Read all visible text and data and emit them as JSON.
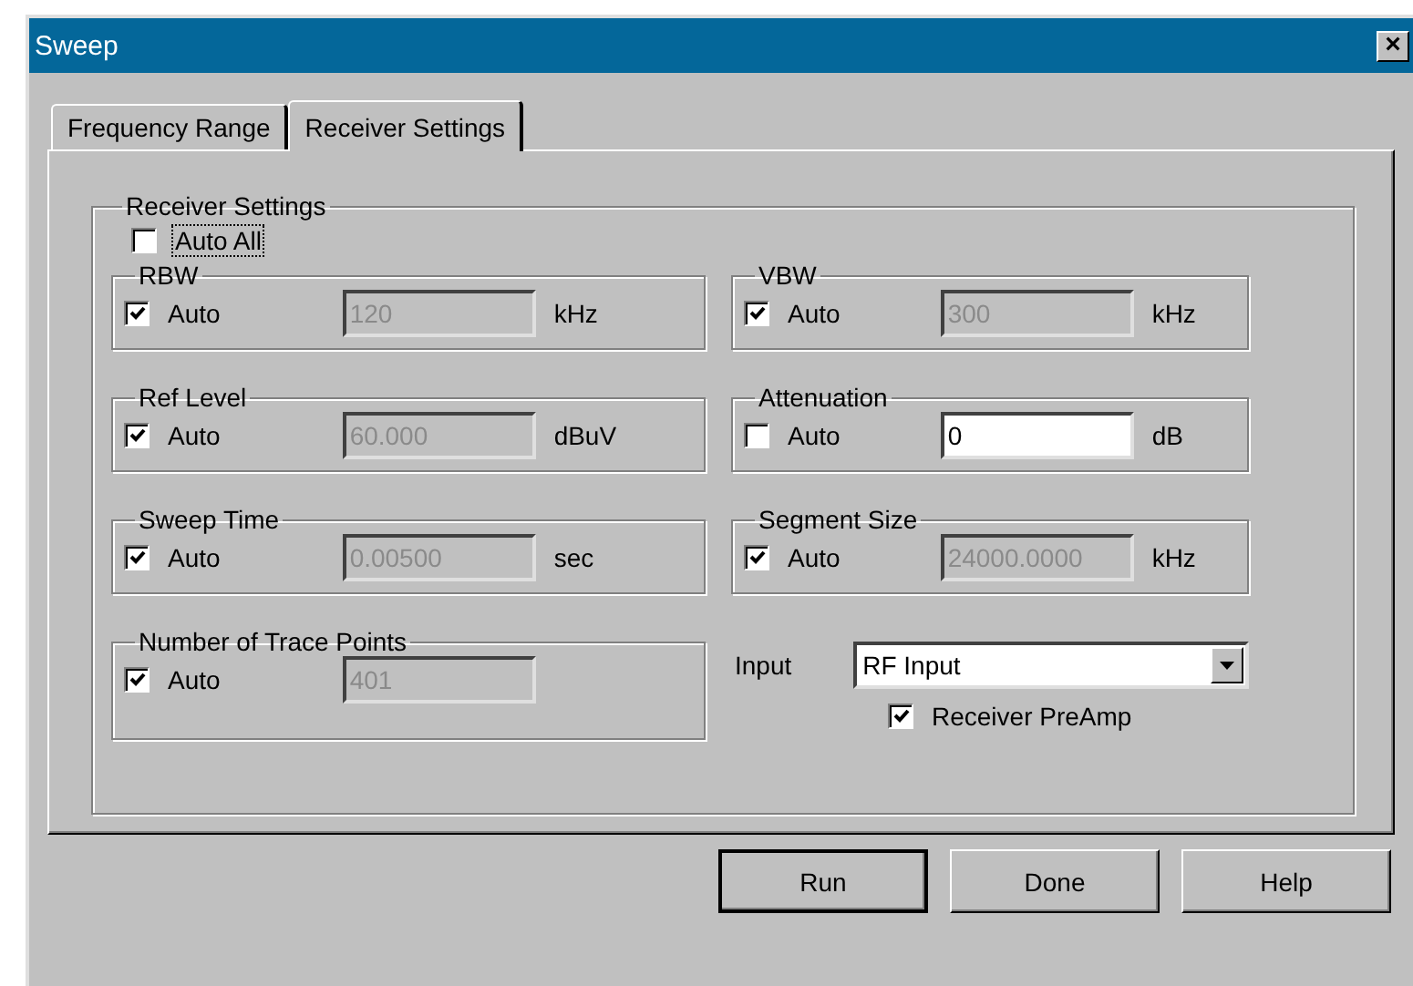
{
  "window": {
    "title": "Sweep",
    "close": "×"
  },
  "tabs": [
    {
      "label": "Frequency Range",
      "selected": false
    },
    {
      "label": "Receiver Settings",
      "selected": true
    }
  ],
  "panel": {
    "title": "Receiver Settings",
    "auto_all": {
      "label": "Auto All",
      "checked": false,
      "focused": true
    },
    "groups": [
      {
        "title": "RBW",
        "auto_label": "Auto",
        "auto": true,
        "value": "120",
        "disabled": true,
        "unit": "kHz"
      },
      {
        "title": "VBW",
        "auto_label": "Auto",
        "auto": true,
        "value": "300",
        "disabled": true,
        "unit": "kHz"
      },
      {
        "title": "Ref Level",
        "auto_label": "Auto",
        "auto": true,
        "value": "60.000",
        "disabled": true,
        "unit": "dBuV"
      },
      {
        "title": "Attenuation",
        "auto_label": "Auto",
        "auto": false,
        "value": "0",
        "disabled": false,
        "unit": "dB"
      },
      {
        "title": "Sweep Time",
        "auto_label": "Auto",
        "auto": true,
        "value": "0.00500",
        "disabled": true,
        "unit": "sec"
      },
      {
        "title": "Segment Size",
        "auto_label": "Auto",
        "auto": true,
        "value": "24000.0000",
        "disabled": true,
        "unit": "kHz"
      },
      {
        "title": "Number of Trace Points",
        "auto_label": "Auto",
        "auto": true,
        "value": "401",
        "disabled": true
      }
    ],
    "input": {
      "label": "Input",
      "value": "RF Input"
    },
    "preamp": {
      "label": "Receiver PreAmp",
      "checked": true
    }
  },
  "buttons": [
    {
      "label": "Run",
      "default": true
    },
    {
      "label": "Done",
      "default": false
    },
    {
      "label": "Help",
      "default": false
    }
  ]
}
